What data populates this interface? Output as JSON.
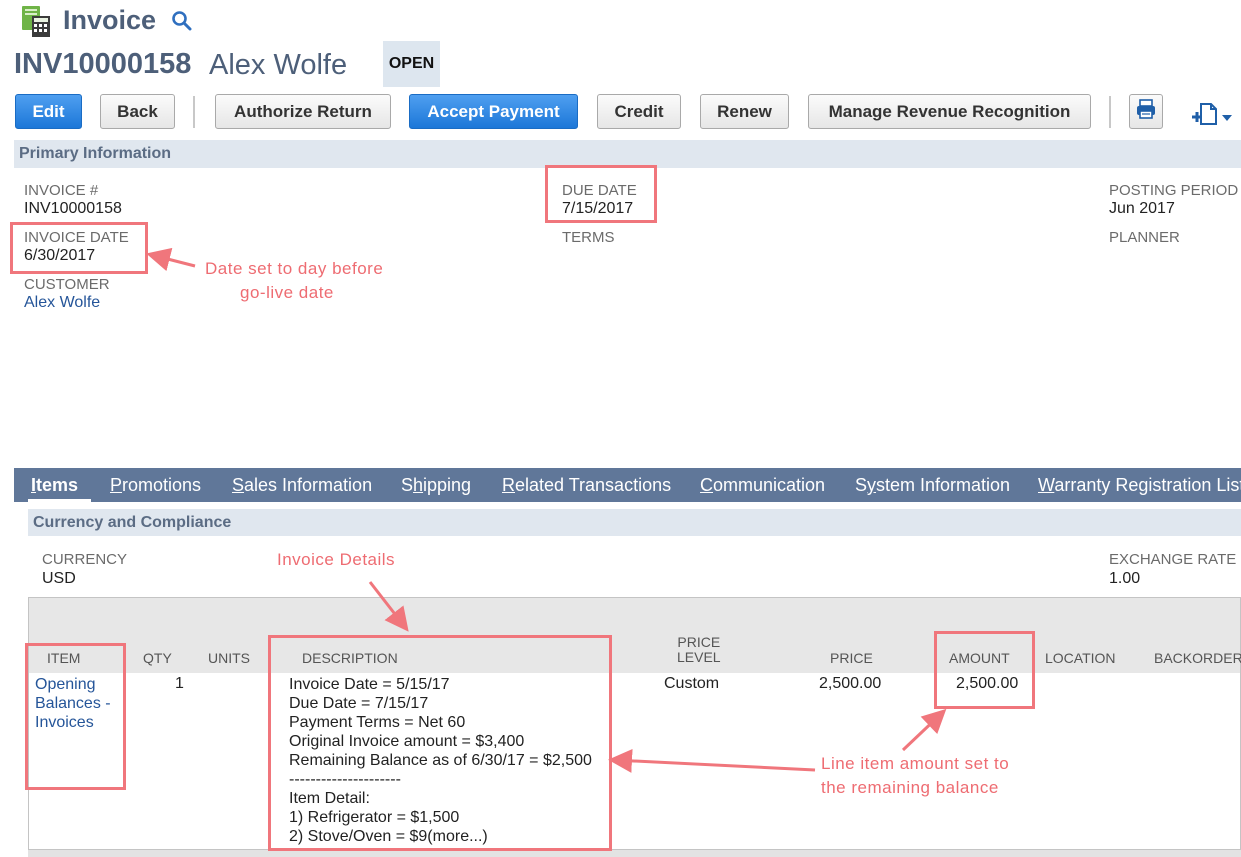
{
  "header": {
    "title": "Invoice",
    "record_id": "INV10000158",
    "record_name": "Alex Wolfe",
    "status": "OPEN"
  },
  "toolbar": {
    "edit": "Edit",
    "back": "Back",
    "authorize_return": "Authorize Return",
    "accept_payment": "Accept Payment",
    "credit": "Credit",
    "renew": "Renew",
    "manage_revenue": "Manage Revenue Recognition"
  },
  "primary": {
    "section_title": "Primary Information",
    "invoice_no_label": "INVOICE #",
    "invoice_no": "INV10000158",
    "invoice_date_label": "INVOICE DATE",
    "invoice_date": "6/30/2017",
    "customer_label": "CUSTOMER",
    "customer": "Alex Wolfe",
    "due_date_label": "DUE DATE",
    "due_date": "7/15/2017",
    "terms_label": "TERMS",
    "posting_period_label": "POSTING PERIOD",
    "posting_period": "Jun 2017",
    "planner_label": "PLANNER"
  },
  "tabs": [
    {
      "accel": "I",
      "rest": "tems"
    },
    {
      "accel": "P",
      "rest": "romotions"
    },
    {
      "accel": "S",
      "rest": "ales Information"
    },
    {
      "pre": "S",
      "accel": "h",
      "rest": "ipping"
    },
    {
      "accel": "R",
      "rest": "elated Transactions"
    },
    {
      "accel": "C",
      "rest": "ommunication"
    },
    {
      "pre": "S",
      "accel": "y",
      "rest": "stem Information"
    },
    {
      "accel": "W",
      "rest": "arranty Registration List"
    }
  ],
  "currency_section": {
    "title": "Currency and Compliance",
    "currency_label": "CURRENCY",
    "currency": "USD",
    "exchange_rate_label": "EXCHANGE RATE",
    "exchange_rate": "1.00"
  },
  "items_table": {
    "columns": {
      "item": "ITEM",
      "qty": "QTY",
      "units": "UNITS",
      "description": "DESCRIPTION",
      "price_level_1": "PRICE",
      "price_level_2": "LEVEL",
      "price": "PRICE",
      "amount": "AMOUNT",
      "location": "LOCATION",
      "backorder": "BACKORDER"
    },
    "row": {
      "item_lines": [
        "Opening",
        "Balances -",
        "Invoices"
      ],
      "qty": "1",
      "price_level": "Custom",
      "price": "2,500.00",
      "amount": "2,500.00",
      "description_lines": [
        "Invoice Date = 5/15/17",
        "Due Date = 7/15/17",
        "Payment Terms = Net 60",
        "Original Invoice amount = $3,400",
        "Remaining Balance as of 6/30/17 = $2,500",
        "---------------------",
        "Item Detail:",
        "1) Refrigerator = $1,500",
        "2) Stove/Oven = $9(more...)"
      ]
    }
  },
  "annotations": {
    "invoice_date_note_1": "Date set to day before",
    "invoice_date_note_2": "go-live date",
    "details_note": "Invoice Details",
    "amount_note_1": "Line item amount set to",
    "amount_note_2": "the remaining balance"
  },
  "colors": {
    "accent_blue": "#1c77d8",
    "tab_bar": "#607799",
    "annotation": "#f0767c"
  },
  "icons": [
    "invoice-app-icon",
    "search-icon",
    "print-icon",
    "new-document-icon",
    "chevron-down-icon"
  ]
}
